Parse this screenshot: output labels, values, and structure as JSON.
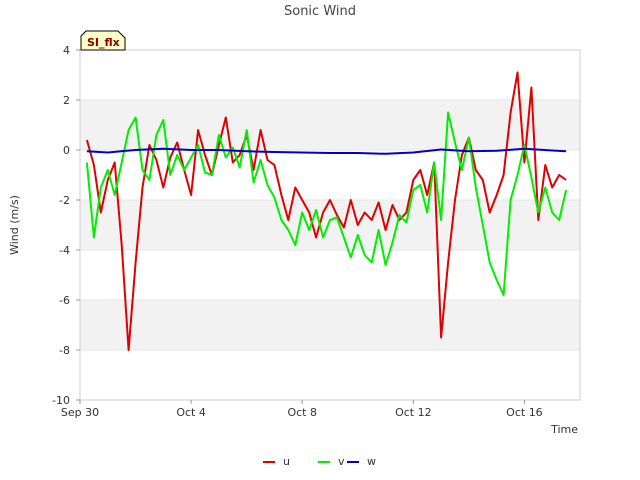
{
  "chart_data": {
    "type": "line",
    "title": "Sonic Wind",
    "badge": "SI_flx",
    "xlabel": "Time",
    "ylabel": "Wind (m/s)",
    "x_start": "2023-09-30",
    "xlim": [
      "2023-09-30",
      "2023-10-18"
    ],
    "x_tick_dates": [
      "2023-09-30",
      "2023-10-04",
      "2023-10-08",
      "2023-10-12",
      "2023-10-16"
    ],
    "x_tick_labels": [
      "Sep 30",
      "Oct 4",
      "Oct 8",
      "Oct 12",
      "Oct 16"
    ],
    "ylim": [
      -10,
      4
    ],
    "y_ticks": [
      -10,
      -8,
      -6,
      -4,
      -2,
      0,
      2,
      4
    ],
    "y_tick_labels": [
      "-10",
      "-8",
      "-6",
      "-4",
      "-2",
      "0",
      "2",
      "4"
    ],
    "legend_position": "bottom-center",
    "grid": "horizontal bands",
    "series": [
      {
        "name": "u",
        "color": "#e00000",
        "x": [
          "2023-09-30T06:00",
          "2023-09-30T12:00",
          "2023-09-30T18:00",
          "2023-10-01T00:00",
          "2023-10-01T06:00",
          "2023-10-01T12:00",
          "2023-10-01T18:00",
          "2023-10-02T00:00",
          "2023-10-02T06:00",
          "2023-10-02T12:00",
          "2023-10-02T18:00",
          "2023-10-03T00:00",
          "2023-10-03T06:00",
          "2023-10-03T12:00",
          "2023-10-03T18:00",
          "2023-10-04T00:00",
          "2023-10-04T06:00",
          "2023-10-04T12:00",
          "2023-10-04T18:00",
          "2023-10-05T00:00",
          "2023-10-05T06:00",
          "2023-10-05T12:00",
          "2023-10-05T18:00",
          "2023-10-06T00:00",
          "2023-10-06T06:00",
          "2023-10-06T12:00",
          "2023-10-06T18:00",
          "2023-10-07T00:00",
          "2023-10-07T06:00",
          "2023-10-07T12:00",
          "2023-10-07T18:00",
          "2023-10-08T00:00",
          "2023-10-08T06:00",
          "2023-10-08T12:00",
          "2023-10-08T18:00",
          "2023-10-09T00:00",
          "2023-10-09T06:00",
          "2023-10-09T12:00",
          "2023-10-09T18:00",
          "2023-10-10T00:00",
          "2023-10-10T06:00",
          "2023-10-10T12:00",
          "2023-10-10T18:00",
          "2023-10-11T00:00",
          "2023-10-11T06:00",
          "2023-10-11T12:00",
          "2023-10-11T18:00",
          "2023-10-12T00:00",
          "2023-10-12T06:00",
          "2023-10-12T12:00",
          "2023-10-12T18:00",
          "2023-10-13T00:00",
          "2023-10-13T06:00",
          "2023-10-13T12:00",
          "2023-10-13T18:00",
          "2023-10-14T00:00",
          "2023-10-14T06:00",
          "2023-10-14T12:00",
          "2023-10-14T18:00",
          "2023-10-15T00:00",
          "2023-10-15T06:00",
          "2023-10-15T12:00",
          "2023-10-15T18:00",
          "2023-10-16T00:00",
          "2023-10-16T06:00",
          "2023-10-16T12:00",
          "2023-10-16T18:00",
          "2023-10-17T00:00",
          "2023-10-17T06:00",
          "2023-10-17T12:00"
        ],
        "y": [
          0.4,
          -0.6,
          -2.5,
          -1.2,
          -0.5,
          -3.8,
          -8.0,
          -4.5,
          -1.5,
          0.2,
          -0.4,
          -1.5,
          -0.3,
          0.3,
          -0.8,
          -1.8,
          0.8,
          -0.2,
          -1.0,
          0.2,
          1.3,
          -0.5,
          -0.2,
          0.6,
          -0.8,
          0.8,
          -0.4,
          -0.6,
          -1.8,
          -2.8,
          -1.5,
          -2.0,
          -2.5,
          -3.5,
          -2.5,
          -2.0,
          -2.6,
          -3.1,
          -2.0,
          -3.0,
          -2.5,
          -2.8,
          -2.1,
          -3.2,
          -2.2,
          -2.8,
          -2.5,
          -1.2,
          -0.8,
          -1.8,
          -0.5,
          -7.5,
          -4.5,
          -2.0,
          -0.2,
          0.5,
          -0.8,
          -1.2,
          -2.5,
          -1.8,
          -1.0,
          1.5,
          3.1,
          -0.5,
          2.5,
          -2.8,
          -0.6,
          -1.5,
          -1.0,
          -1.2
        ]
      },
      {
        "name": "v",
        "color": "#00ee00",
        "x": [
          "2023-09-30T06:00",
          "2023-09-30T12:00",
          "2023-09-30T18:00",
          "2023-10-01T00:00",
          "2023-10-01T06:00",
          "2023-10-01T12:00",
          "2023-10-01T18:00",
          "2023-10-02T00:00",
          "2023-10-02T06:00",
          "2023-10-02T12:00",
          "2023-10-02T18:00",
          "2023-10-03T00:00",
          "2023-10-03T06:00",
          "2023-10-03T12:00",
          "2023-10-03T18:00",
          "2023-10-04T00:00",
          "2023-10-04T06:00",
          "2023-10-04T12:00",
          "2023-10-04T18:00",
          "2023-10-05T00:00",
          "2023-10-05T06:00",
          "2023-10-05T12:00",
          "2023-10-05T18:00",
          "2023-10-06T00:00",
          "2023-10-06T06:00",
          "2023-10-06T12:00",
          "2023-10-06T18:00",
          "2023-10-07T00:00",
          "2023-10-07T06:00",
          "2023-10-07T12:00",
          "2023-10-07T18:00",
          "2023-10-08T00:00",
          "2023-10-08T06:00",
          "2023-10-08T12:00",
          "2023-10-08T18:00",
          "2023-10-09T00:00",
          "2023-10-09T06:00",
          "2023-10-09T12:00",
          "2023-10-09T18:00",
          "2023-10-10T00:00",
          "2023-10-10T06:00",
          "2023-10-10T12:00",
          "2023-10-10T18:00",
          "2023-10-11T00:00",
          "2023-10-11T06:00",
          "2023-10-11T12:00",
          "2023-10-11T18:00",
          "2023-10-12T00:00",
          "2023-10-12T06:00",
          "2023-10-12T12:00",
          "2023-10-12T18:00",
          "2023-10-13T00:00",
          "2023-10-13T06:00",
          "2023-10-13T12:00",
          "2023-10-13T18:00",
          "2023-10-14T00:00",
          "2023-10-14T06:00",
          "2023-10-14T12:00",
          "2023-10-14T18:00",
          "2023-10-15T00:00",
          "2023-10-15T06:00",
          "2023-10-15T12:00",
          "2023-10-15T18:00",
          "2023-10-16T00:00",
          "2023-10-16T06:00",
          "2023-10-16T12:00",
          "2023-10-16T18:00",
          "2023-10-17T00:00",
          "2023-10-17T06:00",
          "2023-10-17T12:00"
        ],
        "y": [
          -0.5,
          -3.5,
          -1.5,
          -0.8,
          -1.8,
          -0.5,
          0.8,
          1.3,
          -0.8,
          -1.2,
          0.6,
          1.2,
          -1.0,
          -0.2,
          -0.8,
          -0.3,
          0.2,
          -0.9,
          -1.0,
          0.6,
          -0.3,
          0.1,
          -0.7,
          0.8,
          -1.3,
          -0.4,
          -1.4,
          -1.9,
          -2.8,
          -3.2,
          -3.8,
          -2.5,
          -3.2,
          -2.4,
          -3.5,
          -2.8,
          -2.7,
          -3.5,
          -4.3,
          -3.4,
          -4.2,
          -4.5,
          -3.2,
          -4.6,
          -3.7,
          -2.6,
          -2.9,
          -1.6,
          -1.4,
          -2.5,
          -0.5,
          -2.8,
          1.5,
          0.3,
          -0.8,
          0.5,
          -1.5,
          -3.0,
          -4.5,
          -5.2,
          -5.8,
          -2.0,
          -1.0,
          0.2,
          -1.1,
          -2.5,
          -1.5,
          -2.5,
          -2.8,
          -1.6
        ]
      },
      {
        "name": "w",
        "color": "#0000cc",
        "x": [
          "2023-09-30T06:00",
          "2023-10-01T00:00",
          "2023-10-02T00:00",
          "2023-10-03T00:00",
          "2023-10-04T00:00",
          "2023-10-05T00:00",
          "2023-10-06T00:00",
          "2023-10-07T00:00",
          "2023-10-08T00:00",
          "2023-10-09T00:00",
          "2023-10-10T00:00",
          "2023-10-11T00:00",
          "2023-10-12T00:00",
          "2023-10-13T00:00",
          "2023-10-14T00:00",
          "2023-10-15T00:00",
          "2023-10-16T00:00",
          "2023-10-17T00:00",
          "2023-10-17T12:00"
        ],
        "y": [
          -0.05,
          -0.1,
          0.0,
          0.05,
          0.0,
          0.0,
          -0.05,
          -0.08,
          -0.1,
          -0.12,
          -0.12,
          -0.15,
          -0.1,
          0.02,
          -0.05,
          -0.03,
          0.05,
          -0.02,
          -0.05
        ]
      }
    ]
  }
}
